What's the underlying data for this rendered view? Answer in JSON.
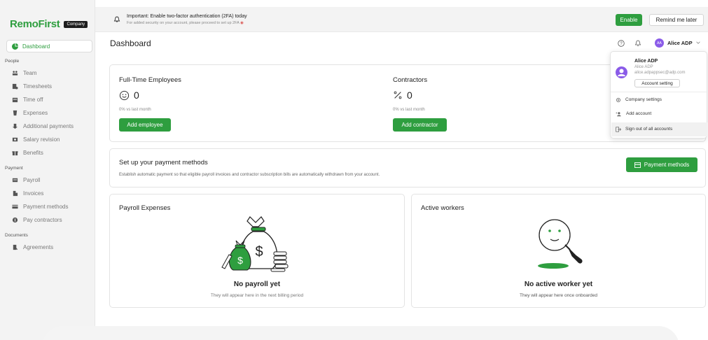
{
  "app": {
    "logo": "RemoFirst",
    "logo_badge": "Company"
  },
  "sidebar": {
    "active": {
      "label": "Dashboard",
      "icon": "pie-chart-icon"
    },
    "sections": [
      {
        "title": "People",
        "items": [
          {
            "label": "Team",
            "icon": "team-icon"
          },
          {
            "label": "Timesheets",
            "icon": "timesheets-icon"
          },
          {
            "label": "Time off",
            "icon": "calendar-icon"
          },
          {
            "label": "Expenses",
            "icon": "expenses-icon"
          },
          {
            "label": "Additional payments",
            "icon": "additional-payments-icon"
          },
          {
            "label": "Salary revision",
            "icon": "salary-revision-icon"
          },
          {
            "label": "Benefits",
            "icon": "gift-icon"
          }
        ]
      },
      {
        "title": "Payment",
        "items": [
          {
            "label": "Payroll",
            "icon": "payroll-icon"
          },
          {
            "label": "Invoices",
            "icon": "invoice-icon"
          },
          {
            "label": "Payment methods",
            "icon": "card-icon"
          },
          {
            "label": "Pay contractors",
            "icon": "pay-icon"
          }
        ]
      },
      {
        "title": "Documents",
        "items": [
          {
            "label": "Agreements",
            "icon": "agreement-icon"
          }
        ]
      }
    ]
  },
  "banner": {
    "title": "Important: Enable two-factor authentication (2FA) today",
    "subtitle": "For added security on your account, please proceed to set up 2FA",
    "enable_label": "Enable",
    "remind_label": "Remind me later"
  },
  "header": {
    "title": "Dashboard",
    "user_initials": "AA",
    "user_name": "Alice ADP"
  },
  "employees_card": {
    "title": "Full-Time Employees",
    "count": "0",
    "delta": "0% vs last month",
    "button": "Add employee"
  },
  "contractors_card": {
    "title": "Contractors",
    "count": "0",
    "delta": "0% vs last month",
    "button": "Add contractor"
  },
  "payment_setup": {
    "title": "Set up your payment methods",
    "description": "Establish automatic payment so that eligible payroll invoices and contractor subscription bills are automatically withdrawn from your account.",
    "button": "Payment methods"
  },
  "payroll_expenses": {
    "title": "Payroll Expenses",
    "empty_title": "No payroll yet",
    "empty_sub": "They will appear here in the next billing period"
  },
  "active_workers": {
    "title": "Active workers",
    "empty_title": "No active worker yet",
    "empty_sub": "They will appear here once onboarded"
  },
  "dropdown": {
    "name": "Alice ADP",
    "sub_name": "Alice ADP",
    "email": "alice.adpappsec@adp.com",
    "account_setting": "Account setting",
    "items": [
      "Company settings",
      "Add account",
      "Sign out of all accounts"
    ]
  },
  "colors": {
    "brand_green": "#2e9e3f",
    "avatar_purple": "#8a5be8"
  }
}
